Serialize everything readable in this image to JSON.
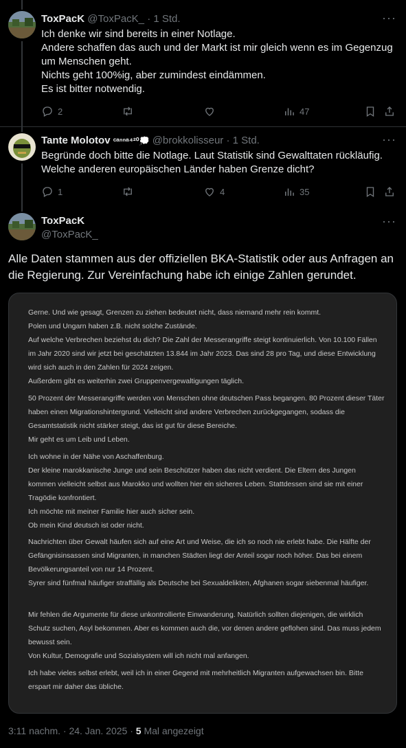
{
  "tweet1": {
    "name": "ToxPacK",
    "handle": "@ToxPacK_",
    "time": "· 1 Std.",
    "text": "Ich denke wir sind bereits in einer Notlage.\nAndere schaffen das auch und der Markt ist mir gleich wenn es im Gegenzug um Menschen geht.\nNichts geht 100%ig, aber zumindest eindämmen.\nEs ist bitter notwendig.",
    "replies": "2",
    "retweets": "",
    "likes": "",
    "views": "47"
  },
  "tweet2": {
    "name": "Tante Molotov",
    "name_suffix": "ᶜᵃⁿⁿᵃ⁴²⁰💭",
    "handle": "@brokkolisseur",
    "time": "· 1 Std.",
    "text": "Begründe doch bitte die Notlage. Laut Statistik sind Gewalttaten rückläufig.\nWelche anderen europäischen Länder haben Grenze dicht?",
    "replies": "1",
    "retweets": "",
    "likes": "4",
    "views": "35"
  },
  "main": {
    "name": "ToxPacK",
    "handle": "@ToxPacK_",
    "text": "Alle Daten stammen aus der offiziellen BKA-Statistik oder aus Anfragen an die Regierung. Zur Vereinfachung habe ich einige Zahlen gerundet.",
    "image_paragraphs": [
      "Gerne. Und wie gesagt, Grenzen zu ziehen bedeutet nicht, dass niemand mehr rein kommt.\nPolen und Ungarn haben z.B. nicht solche Zustände.\nAuf welche Verbrechen beziehst du dich? Die Zahl der Messerangriffe steigt kontinuierlich. Von 10.100 Fällen im Jahr 2020 sind wir jetzt bei geschätzten 13.844 im Jahr 2023. Das sind 28 pro Tag, und diese Entwicklung wird sich auch in den Zahlen für 2024 zeigen.\nAußerdem gibt es weiterhin zwei Gruppenvergewaltigungen täglich.",
      "50 Prozent der Messerangriffe werden von Menschen ohne deutschen Pass begangen. 80 Prozent dieser Täter haben einen Migrationshintergrund. Vielleicht sind andere Verbrechen zurückgegangen, sodass die Gesamtstatistik nicht stärker steigt, das ist gut für diese Bereiche.\nMir geht es um Leib und Leben.",
      "Ich wohne in der Nähe von Aschaffenburg.\nDer kleine marokkanische Junge und sein Beschützer haben das nicht verdient. Die Eltern des Jungen kommen vielleicht selbst aus Marokko und wollten hier ein sicheres Leben. Stattdessen sind sie mit einer Tragödie konfrontiert.\nIch möchte mit meiner Familie hier auch sicher sein.\nOb mein Kind deutsch ist oder nicht.",
      "Nachrichten über Gewalt häufen sich auf eine Art und Weise, die ich so noch nie erlebt habe. Die Hälfte der Gefängnisinsassen sind Migranten, in manchen Städten liegt der Anteil sogar noch höher. Das bei einem Bevölkerungsanteil von nur 14 Prozent.\nSyrer sind fünfmal häufiger straffällig als Deutsche bei Sexualdelikten, Afghanen sogar siebenmal häufiger.",
      "Mir fehlen die Argumente für diese unkontrollierte Einwanderung. Natürlich sollten diejenigen, die wirklich Schutz suchen, Asyl bekommen. Aber es kommen auch die, vor denen andere geflohen sind. Das muss jedem bewusst sein.\nVon Kultur, Demografie und Sozialsystem will ich nicht mal anfangen.",
      "Ich habe vieles selbst erlebt, weil ich in einer Gegend mit mehrheitlich Migranten aufgewachsen bin. Bitte erspart mir daher das übliche."
    ],
    "time": "3:11 nachm. · 24. Jan. 2025 ·",
    "views_count": "5",
    "views_label": "Mal angezeigt"
  },
  "colors": {
    "background": "#000000",
    "text": "#e7e9ea",
    "muted": "#71767b",
    "border": "#2f3336",
    "card": "#202020"
  },
  "icons": [
    "reply-icon",
    "retweet-icon",
    "like-icon",
    "views-icon",
    "bookmark-icon",
    "share-icon",
    "more-icon"
  ]
}
